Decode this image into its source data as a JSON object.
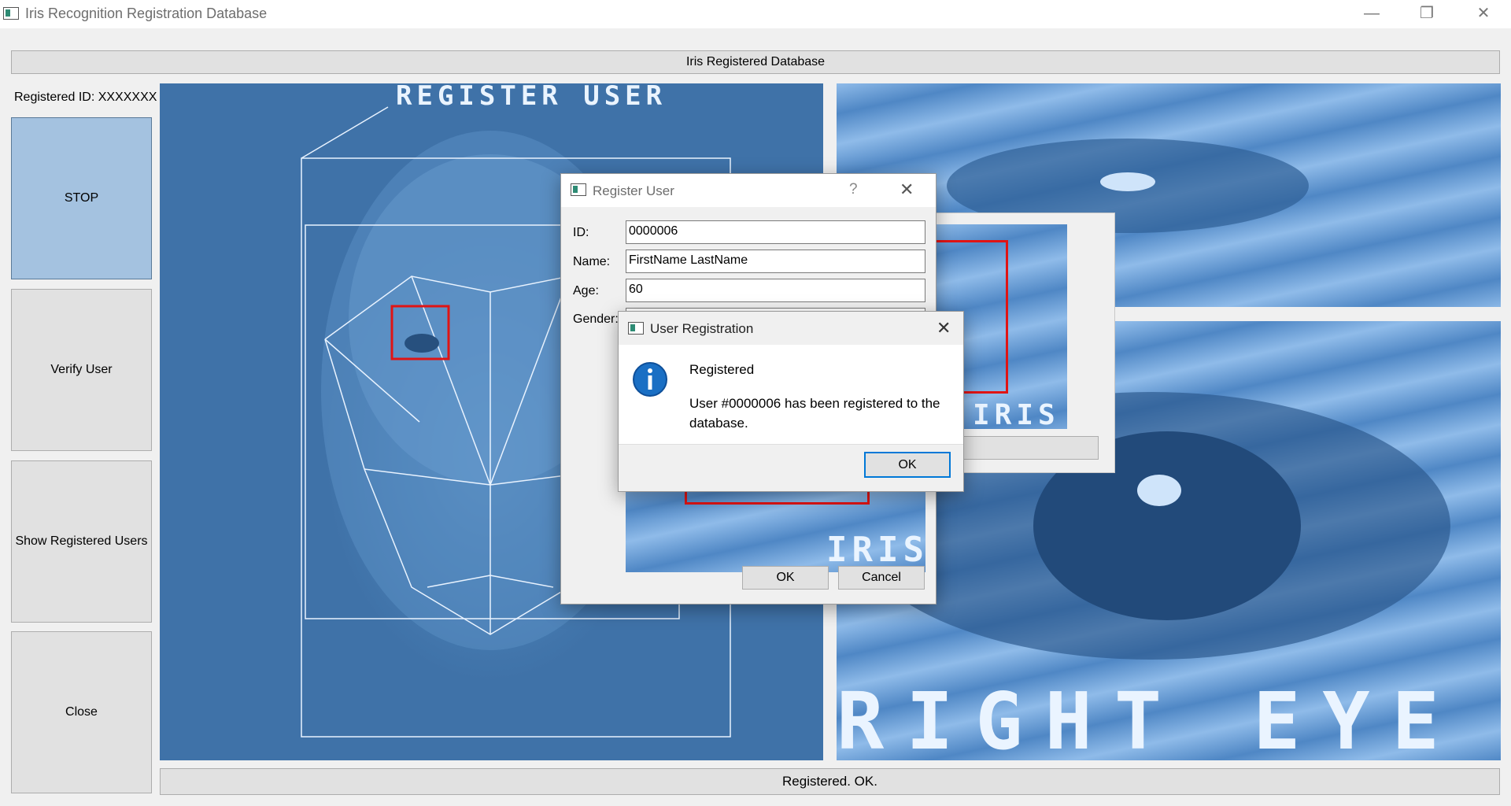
{
  "window": {
    "title": "Iris Recognition Registration Database",
    "minimize_icon": "minimize-icon",
    "restore_icon": "restore-icon",
    "close_icon": "close-icon"
  },
  "header_button": "Iris Registered Database",
  "registered_id_label": "Registered ID: XXXXXXX",
  "sidebar": [
    {
      "label": "STOP"
    },
    {
      "label": "Verify User"
    },
    {
      "label": "Show Registered Users"
    },
    {
      "label": "Close"
    }
  ],
  "face_image": {
    "overlay_text": "REGISTER USER"
  },
  "right_eye_image": {
    "overlay_text": "RIGHT EYE"
  },
  "iris_thumb": {
    "overlay_text": "IRIS"
  },
  "status_text": "Registered. OK.",
  "register_dialog": {
    "title": "Register User",
    "help_icon": "question-icon",
    "fields": [
      {
        "label": "ID:",
        "value": "0000006"
      },
      {
        "label": "Name:",
        "value": "FirstName LastName"
      },
      {
        "label": "Age:",
        "value": "60"
      },
      {
        "label": "Gender:",
        "value": ""
      }
    ],
    "preview_text": "IRIS",
    "ok_label": "OK",
    "cancel_label": "Cancel"
  },
  "message_box": {
    "title": "User Registration",
    "icon": "info-icon",
    "heading": "Registered",
    "body": "User #0000006 has been registered to the database.",
    "ok_label": "OK"
  },
  "colors": {
    "accent": "#0078d7",
    "info_blue": "#1a6fc4",
    "detect_red": "#e01414"
  }
}
